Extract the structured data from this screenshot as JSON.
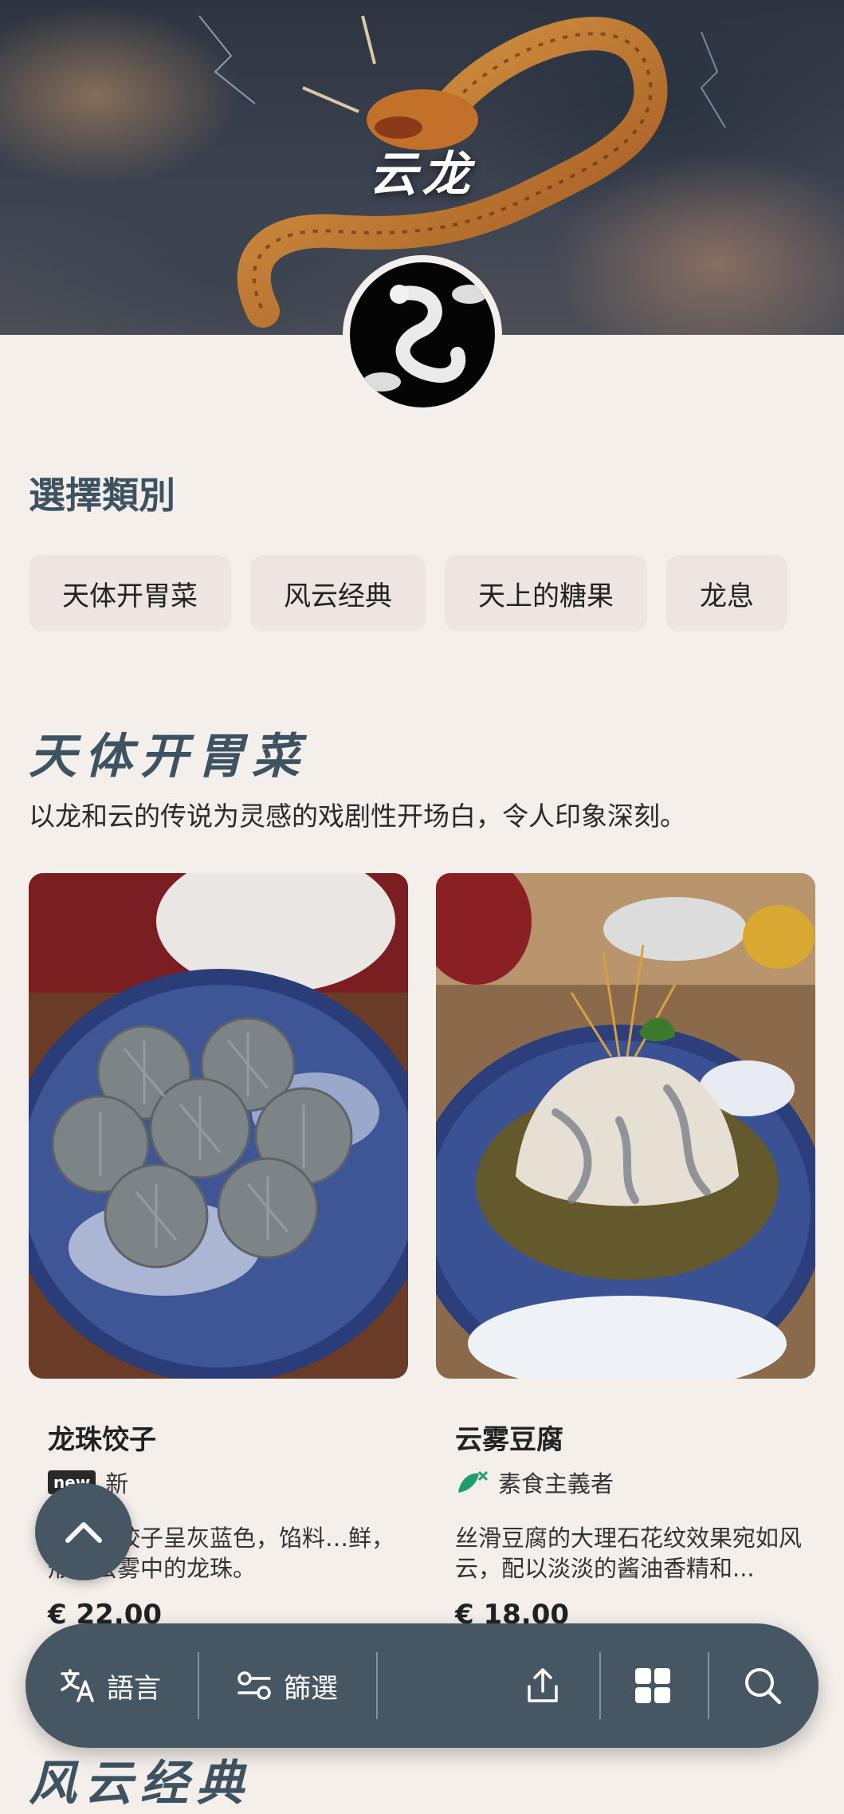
{
  "brand": {
    "title": "云龙"
  },
  "category_section": {
    "label": "選擇類別",
    "chips": [
      "天体开胃菜",
      "风云经典",
      "天上的糖果",
      "龙息"
    ]
  },
  "current_category": {
    "title": "天体开胃菜",
    "description": "以龙和云的传说为灵感的戏剧性开场白，令人印象深刻。"
  },
  "dishes": [
    {
      "name": "龙珠饺子",
      "badge": "new",
      "tag": "新",
      "description": "…出的饺子呈灰蓝色，馅料…鲜，形似云雾中的龙珠。",
      "price": "€ 22.00"
    },
    {
      "name": "云雾豆腐",
      "tag": "素食主義者",
      "description": "丝滑豆腐的大理石花纹效果宛如风云，配以淡淡的酱油香精和...",
      "price": "€ 18.00"
    }
  ],
  "next_category": {
    "title": "风云经典"
  },
  "bottom_bar": {
    "language_label": "語言",
    "filter_label": "篩選",
    "icons": [
      "translate-icon",
      "filter-icon",
      "share-icon",
      "grid-icon",
      "search-icon"
    ]
  },
  "colors": {
    "accent": "#465763",
    "heading": "#3e5361",
    "background": "#f5efeb",
    "chip": "#ece5e1",
    "vegan": "#1f9e6a"
  }
}
